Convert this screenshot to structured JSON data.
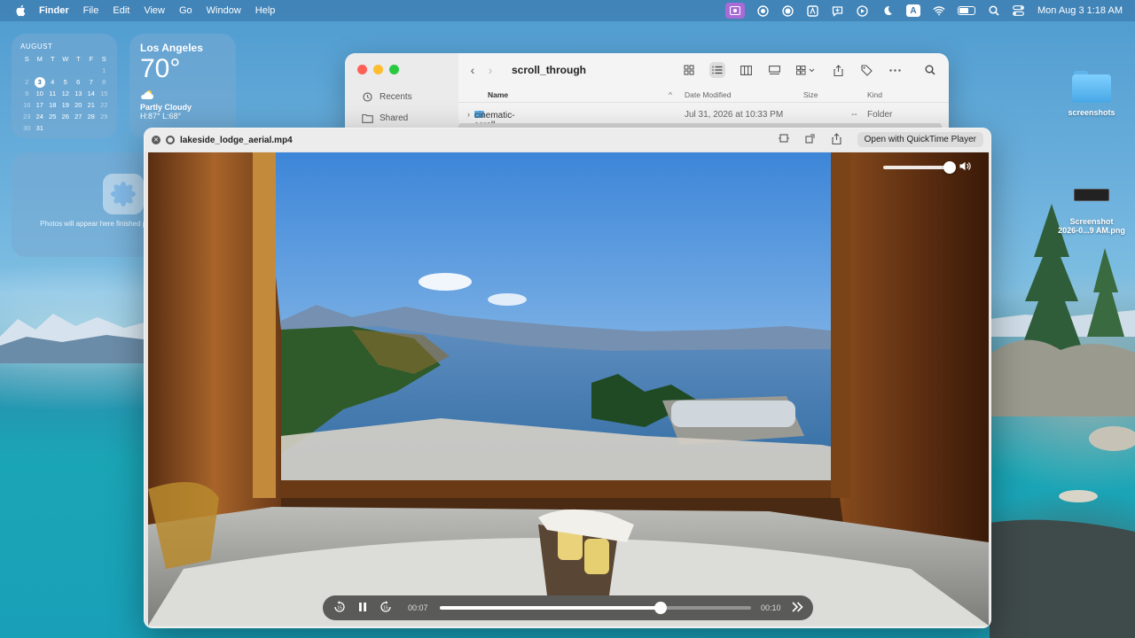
{
  "menubar": {
    "app_name": "Finder",
    "menus": [
      "File",
      "Edit",
      "View",
      "Go",
      "Window",
      "Help"
    ],
    "status_letter": "A",
    "clock": "Mon Aug 3  1:18 AM"
  },
  "calendar_widget": {
    "month": "AUGUST",
    "weekdays": [
      "S",
      "M",
      "T",
      "W",
      "T",
      "F",
      "S"
    ],
    "rows": [
      [
        "",
        "",
        "",
        "",
        "",
        "",
        "1"
      ],
      [
        "2",
        "3",
        "4",
        "5",
        "6",
        "7",
        "8"
      ],
      [
        "9",
        "10",
        "11",
        "12",
        "13",
        "14",
        "15"
      ],
      [
        "16",
        "17",
        "18",
        "19",
        "20",
        "21",
        "22"
      ],
      [
        "23",
        "24",
        "25",
        "26",
        "27",
        "28",
        "29"
      ],
      [
        "30",
        "31",
        "",
        "",
        "",
        "",
        ""
      ]
    ],
    "today": "3"
  },
  "weather_widget": {
    "city": "Los Angeles",
    "temperature": "70°",
    "condition": "Partly Cloudy",
    "hilo": "H:87° L:68°"
  },
  "photos_widget": {
    "message": "Photos will appear here finished proce"
  },
  "desktop_icons": {
    "folder_label": "screenshots",
    "screenshot_label_line1": "Screenshot",
    "screenshot_label_line2": "2026-0...9 AM.png"
  },
  "finder": {
    "title": "scroll_through",
    "sidebar": [
      "Recents",
      "Shared"
    ],
    "columns": {
      "name": "Name",
      "date": "Date Modified",
      "size": "Size",
      "kind": "Kind"
    },
    "rows": [
      {
        "name": "cinematic-scroll",
        "date": "Jul 31, 2026 at 10:33 PM",
        "size": "--",
        "kind": "Folder"
      }
    ]
  },
  "quicklook": {
    "filename": "lakeside_lodge_aerial.mp4",
    "open_with_label": "Open with QuickTime Player",
    "current_time": "00:07",
    "duration": "00:10",
    "progress": 0.71,
    "volume": 1.0
  },
  "colors": {
    "accent_purple": "#a86bd8",
    "finder_folder": "#5cb0ea",
    "close_red": "#ff5f57",
    "minimize_yellow": "#febc2e",
    "zoom_green": "#28c840"
  }
}
